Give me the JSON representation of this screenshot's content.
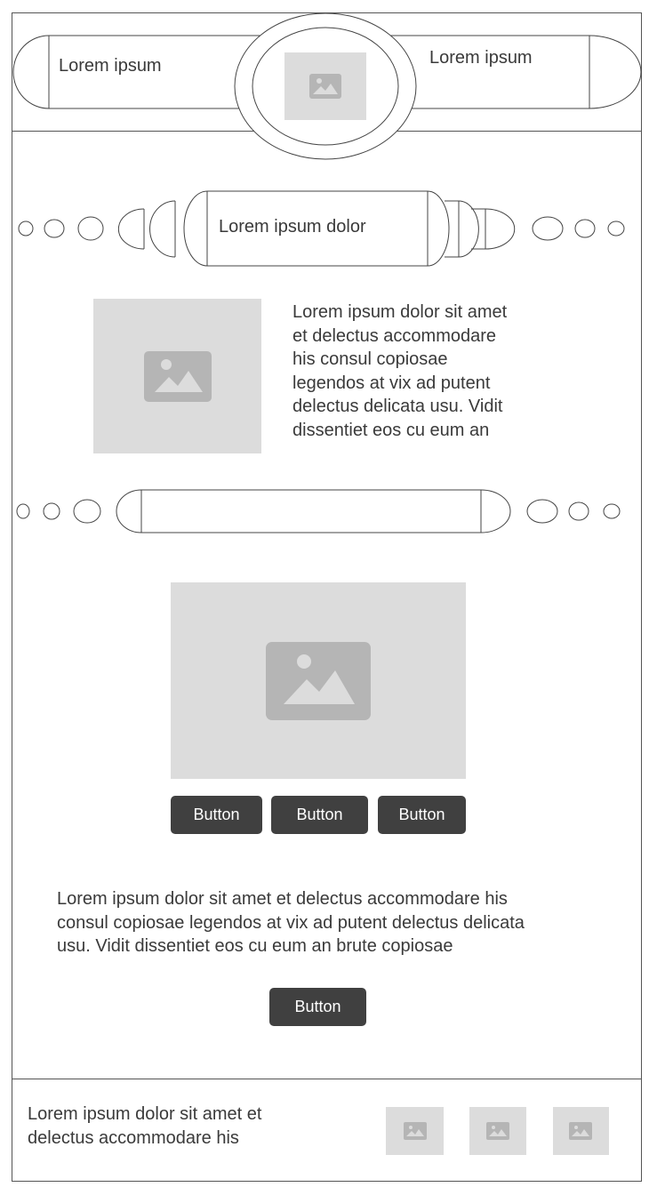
{
  "header": {
    "left_label": "Lorem ipsum",
    "right_label": "Lorem ipsum",
    "logo_icon": "image-icon"
  },
  "nav_bar": {
    "title": "Lorem ipsum dolor"
  },
  "intro": {
    "image_icon": "image-icon",
    "lines": [
      "Lorem ipsum dolor sit amet",
      "et delectus accommodare",
      "his consul copiosae",
      "legendos at vix ad putent",
      "delectus delicata usu. Vidit",
      "dissentiet eos cu eum an"
    ]
  },
  "search_bar": {
    "value": ""
  },
  "media": {
    "image_icon": "image-icon",
    "buttons": [
      "Button",
      "Button",
      "Button"
    ]
  },
  "body_text": {
    "lines": [
      "Lorem ipsum dolor sit amet et delectus accommodare his",
      "consul copiosae legendos at vix ad putent delectus delicata",
      "usu. Vidit dissentiet eos cu eum an brute copiosae"
    ],
    "button_label": "Button"
  },
  "footer": {
    "lines": [
      "Lorem ipsum dolor sit amet et",
      "delectus accommodare his"
    ],
    "thumb_icon": "image-icon"
  },
  "colors": {
    "placeholder": "#dcdcdc",
    "placeholder_icon": "#b5b5b5",
    "button_bg": "#404040",
    "stroke": "#444444"
  }
}
